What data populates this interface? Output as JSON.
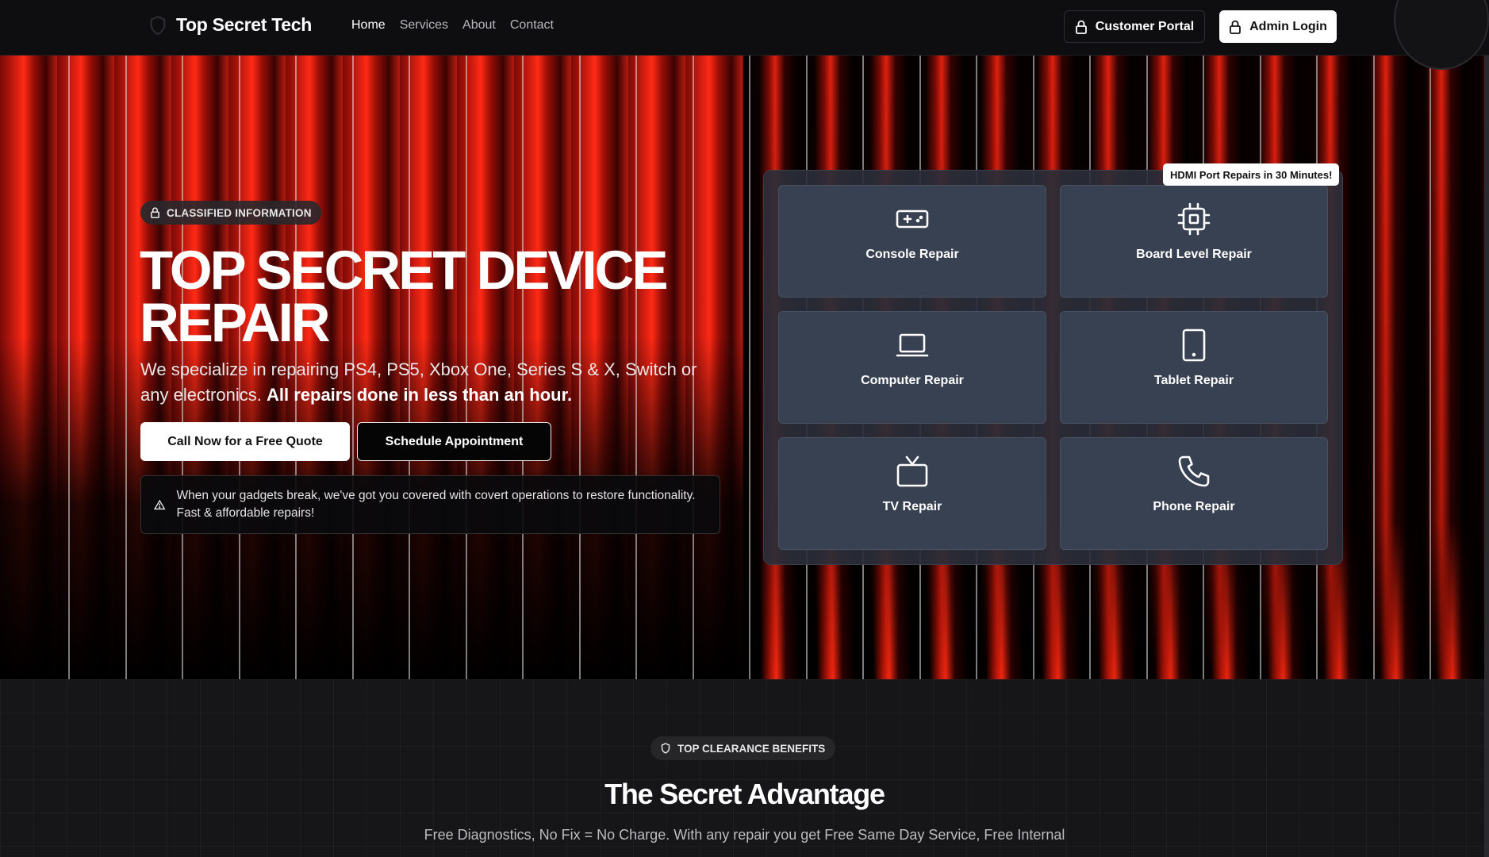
{
  "nav": {
    "brand": "Top Secret Tech",
    "links": [
      "Home",
      "Services",
      "About",
      "Contact"
    ],
    "customer_portal": "Customer Portal",
    "admin_login": "Admin Login"
  },
  "hero": {
    "badge": "CLASSIFIED INFORMATION",
    "title": "TOP SECRET DEVICE REPAIR",
    "subtitle": "We specialize in repairing PS4, PS5, Xbox One, Series S & X, Switch or any electronics.",
    "subtitle_bold": "All repairs done in less than an hour.",
    "cta_call": "Call Now for a Free Quote",
    "cta_schedule": "Schedule Appointment",
    "notice": "When your gadgets break, we've got you covered with covert operations to restore functionality. Fast & affordable repairs!"
  },
  "services": {
    "promo": "HDMI Port Repairs in 30 Minutes!",
    "cards": [
      {
        "label": "Console Repair",
        "icon": "gamepad-icon"
      },
      {
        "label": "Board Level Repair",
        "icon": "chip-icon"
      },
      {
        "label": "Computer Repair",
        "icon": "laptop-icon"
      },
      {
        "label": "Tablet Repair",
        "icon": "tablet-icon"
      },
      {
        "label": "TV Repair",
        "icon": "tv-icon"
      },
      {
        "label": "Phone Repair",
        "icon": "phone-icon"
      }
    ]
  },
  "advantage": {
    "badge": "TOP CLEARANCE BENEFITS",
    "title": "The Secret Advantage",
    "text": "Free Diagnostics, No Fix = No Charge. With any repair you get Free Same Day Service, Free Internal"
  },
  "colors": {
    "accent_red": "#e0200f",
    "card_bg": "#374151",
    "nav_bg": "#0e0e10"
  }
}
